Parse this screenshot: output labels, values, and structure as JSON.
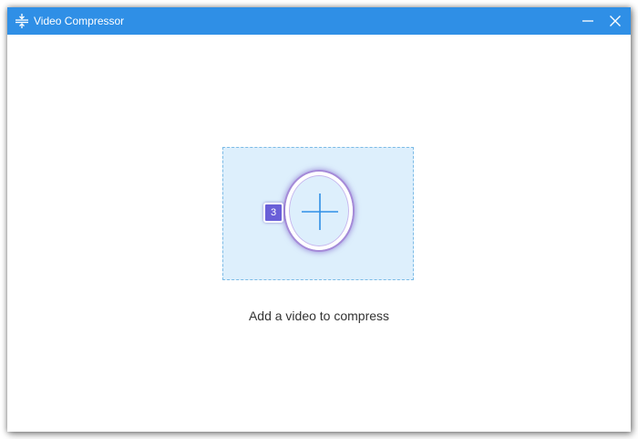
{
  "window": {
    "title": "Video Compressor",
    "app_icon": "compress-arrows-icon",
    "controls": {
      "minimize_icon": "minimize-icon",
      "close_icon": "close-icon"
    }
  },
  "drop_zone": {
    "add_icon": "plus-icon",
    "badge_number": "3",
    "hint": "Add a video to compress"
  },
  "colors": {
    "titlebar": "#2f8fe6",
    "drop_zone_bg": "#ddeffc",
    "drop_zone_border": "#7cbbe6",
    "plus": "#2f8fe6",
    "badge": "#6a5fd8"
  }
}
